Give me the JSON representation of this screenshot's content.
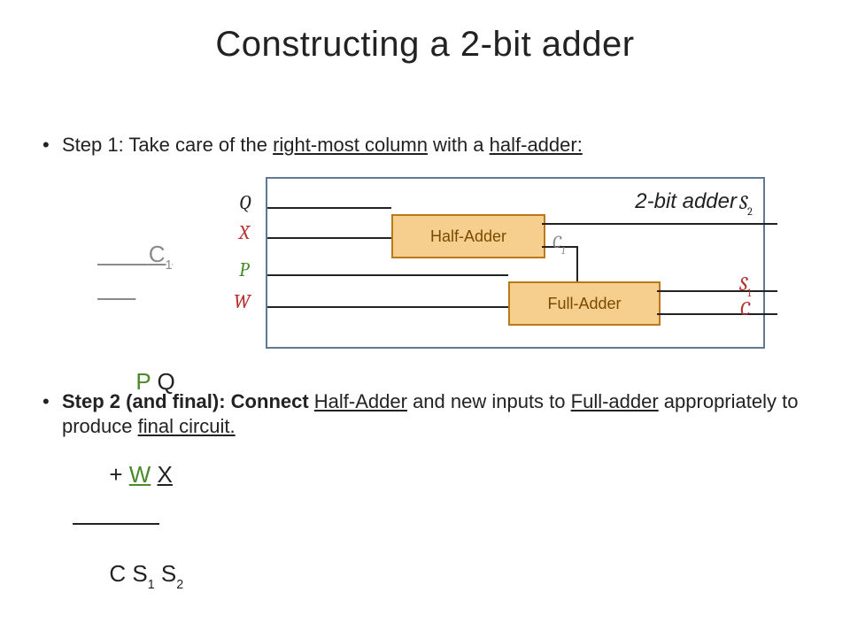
{
  "title": "Constructing a 2-bit adder",
  "step1": {
    "lead": "Step 1: Take care of the ",
    "u1": "right-most column",
    "mid": " with a ",
    "u2": "half-adder:",
    "tail": ""
  },
  "arith": {
    "c1": "C",
    "c1sub": "1",
    "row1_a": "P",
    "row1_b": "Q",
    "plus": "+",
    "row2_a": "W",
    "row2_b": "X",
    "res_c": "C",
    "res_s1": "S",
    "res_s1sub": "1",
    "res_s2": "S",
    "res_s2sub": "2"
  },
  "diagram": {
    "caption": "2-bit adder",
    "Q": "Q",
    "X": "X",
    "P": "P",
    "W": "W",
    "S2": "S",
    "S2sub": "2",
    "C1": "C",
    "C1sub": "1",
    "S1": "S",
    "S1sub": "1",
    "Cout": "C",
    "ha": "Half-Adder",
    "fa": "Full-Adder"
  },
  "step2": {
    "lead": "Step 2 (and final): Connect ",
    "u1": "Half-Adder",
    "mid1": " and new inputs to ",
    "u2": "Full-adder",
    "mid2": " appropriately to produce ",
    "u3": "final circuit.",
    "tail": ""
  }
}
